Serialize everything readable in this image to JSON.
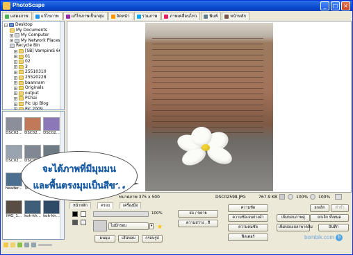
{
  "window": {
    "title": "PhotoScape"
  },
  "tabs": [
    {
      "label": "แสดงภาพ",
      "color": "#4caf50"
    },
    {
      "label": "แก้ไขภาพ",
      "color": "#2196f3"
    },
    {
      "label": "แก้ไขภาพเป็นกลุ่ม",
      "color": "#9c27b0"
    },
    {
      "label": "จัดหน้า",
      "color": "#ff9800"
    },
    {
      "label": "รวมภาพ",
      "color": "#03a9f4"
    },
    {
      "label": "ภาพเคลื่อนไหว",
      "color": "#e91e63"
    },
    {
      "label": "พิมพ์",
      "color": "#607d8b"
    },
    {
      "label": "หน้าหลัก",
      "color": "#795548"
    }
  ],
  "tree": [
    {
      "label": "Desktop",
      "icon": "blue"
    },
    {
      "label": "My Documents",
      "icon": "folder"
    },
    {
      "label": "My Computer",
      "icon": "gray"
    },
    {
      "label": "My Network Places",
      "icon": "gray"
    },
    {
      "label": "Recycle Bin",
      "icon": "gray"
    },
    {
      "label": "[SB] VampireS 66C",
      "icon": "folder"
    },
    {
      "label": "01",
      "icon": "folder"
    },
    {
      "label": "02",
      "icon": "folder"
    },
    {
      "label": "3",
      "icon": "folder"
    },
    {
      "label": "25510310",
      "icon": "folder"
    },
    {
      "label": "25520228",
      "icon": "folder"
    },
    {
      "label": "baannam",
      "icon": "folder"
    },
    {
      "label": "Originals",
      "icon": "folder"
    },
    {
      "label": "output",
      "icon": "folder"
    },
    {
      "label": "PChai",
      "icon": "folder"
    },
    {
      "label": "Pic Up Blog",
      "icon": "folder"
    },
    {
      "label": "Pic 2009",
      "icon": "folder"
    }
  ],
  "thumbnails": [
    {
      "label": "DSC02...",
      "color": "#8a8f99"
    },
    {
      "label": "DSC02...",
      "color": "#c07a5a"
    },
    {
      "label": "DSC02...",
      "color": "#8a78b8"
    },
    {
      "label": "DSC02...",
      "color": "#9aa4b0"
    },
    {
      "label": "DSC02...",
      "color": "#7f8893"
    },
    {
      "label": "DSC02...",
      "color": "#6e7a84"
    },
    {
      "label": "header...",
      "color": "#4d6f8f"
    },
    {
      "label": "IMG_1...",
      "color": "#3d4f63"
    },
    {
      "label": "",
      "color": "#566877"
    },
    {
      "label": "IMG_1...",
      "color": "#5a4d44"
    },
    {
      "label": "koh-kh...",
      "color": "#3f5e7a"
    },
    {
      "label": "koh-kh...",
      "color": "#2e4a66"
    }
  ],
  "status": {
    "size_text": "ขนาดภาพ 375 x 500",
    "filename": "DSC02598.JPG",
    "filesize": "767.9 KB",
    "zoom": "100%",
    "zoom_btn": "100%"
  },
  "edit_tabs": [
    "หน้าหลัก",
    "ครอบ",
    "เครื่องมือ"
  ],
  "edit": {
    "frame_label": "ไม่มีกรอบ",
    "btn_round": "มนมุม",
    "btn_margin": "เส้นขอบ",
    "btn_frame": "กรอบรูป",
    "dd_resize": "ย่อ / ขยาย",
    "dd_bright": "ความสว่าง , สี",
    "dd_auto": "ความชัด",
    "dd_backlight": "ความชัดเจนย่างดำ",
    "dd_sharpen": "ความคมชัด",
    "dd_filter": "ฟิลเตอร์",
    "dd_more1": "เพิ่มขอบภาพคู่",
    "dd_more2": "เพิ่มขอบเบลาพาคล์ม",
    "btn_undo": "ยกเลิก",
    "btn_redo": "ทำซ้ำ",
    "btn_undo_all": "ยกเลิก ทั้งหมด",
    "btn_save": "บันทึก",
    "pct": "100%"
  },
  "callout": {
    "line1": "จะได้ภาพที่มีมุมมน",
    "line2": "และพื้นตรงมุมเป็นสีขาว"
  },
  "watermark": "bombik.com"
}
